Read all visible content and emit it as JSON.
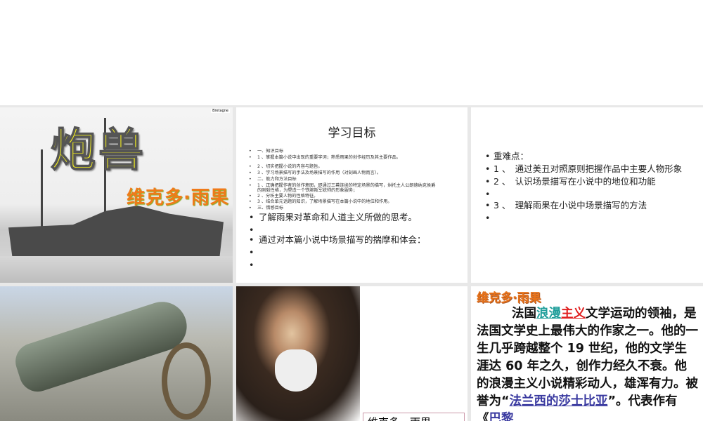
{
  "slide1": {
    "tag": "Bretagne",
    "title": "炮兽",
    "author": "维克多·雨果"
  },
  "slide2": {
    "title": "学习目标",
    "small_items": [
      "一、知识目标",
      "1 、掌握本篇小说中出现的重要字词；熟悉雨果的创作经历及其主要作品。",
      "2 、切实把握小说的内容与题旨。",
      "3 、学习场景描写的手法及场景描写的作用（对刻画人物而言）。",
      "二、能力和方法目标",
      "1 、正确把握作者的创作意图，即通过三幕连续的特定场景的描写，烘托主人公朗德纳克侯爵的刚毅性格，为塑造一个铁腕叛军统帅的形象服务；",
      "2 、分析主要人物的性格特征。",
      "3 、结合单元话题的知识，了解场景描写在本篇小说中的地位和作用。",
      "三、情感目标"
    ],
    "big_items": [
      "了解雨果对革命和人道主义所做的思考。",
      "",
      "通过对本篇小说中场景描写的揣摩和体会：",
      "",
      ""
    ]
  },
  "slide3": {
    "items": [
      "重难点：",
      "1 、　通过美丑对照原则把握作品中主要人物形象",
      "2 、　认识场景描写在小说中的地位和功能",
      "",
      "3 、　理解雨果在小说中场景描写的方法",
      ""
    ]
  },
  "slide5": {
    "caption": "维克多　雨果"
  },
  "slide6": {
    "heading": "维克多·雨果",
    "p1": "法国",
    "l1": "浪漫",
    "l2": "主义",
    "p2": "文学运动的领袖，是法国文学史上最伟大的作家之一。他的一生几乎跨越整个 19 世纪，他的文学生涯达 60 年之久，创作力经久不衰。他的浪漫主义小说精彩动人，雄浑有力。被誉为“",
    "l3": "法兰西的莎士比亚",
    "p3": "”。代表作有《",
    "l4": "巴黎"
  }
}
